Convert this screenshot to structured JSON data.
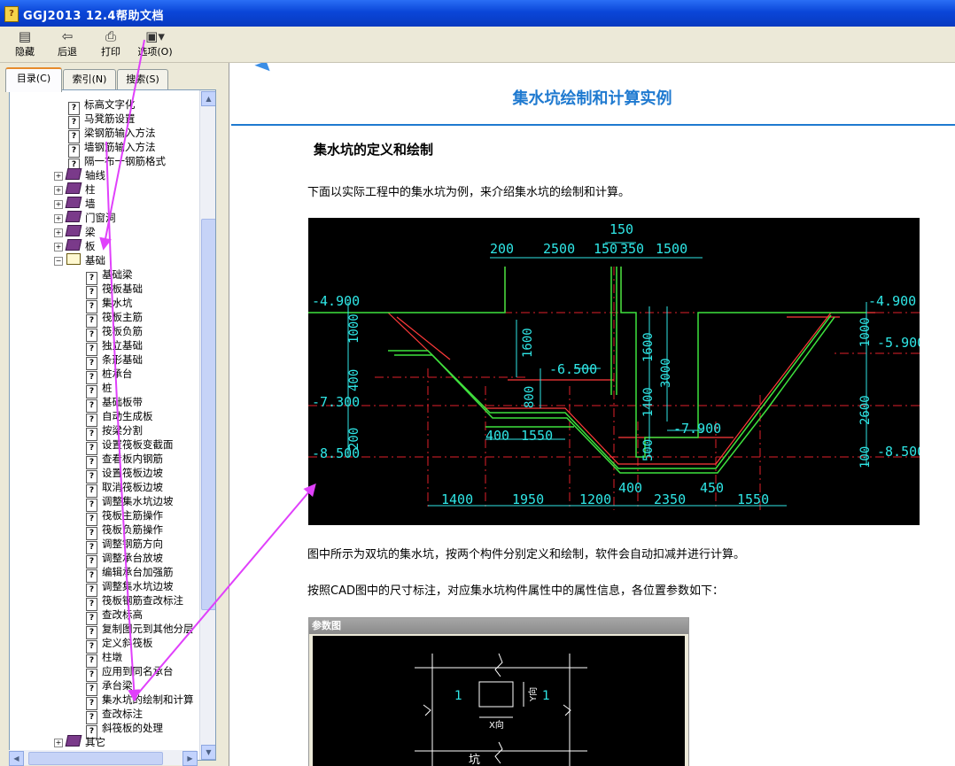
{
  "window": {
    "title": "GGJ2013 12.4帮助文档"
  },
  "toolbar": {
    "hide": "隐藏",
    "back": "后退",
    "print": "打印",
    "options": "选项(O)"
  },
  "tabs": {
    "contents": "目录(C)",
    "index": "索引(N)",
    "search": "搜索(S)"
  },
  "tree": {
    "items": [
      "标高文字化",
      "马凳筋设置",
      "梁钢筋输入方法",
      "墙钢筋输入方法",
      "隔一布一钢筋格式",
      "轴线",
      "柱",
      "墙",
      "门窗洞",
      "梁",
      "板",
      "基础",
      "基础梁",
      "筏板基础",
      "集水坑",
      "筏板主筋",
      "筏板负筋",
      "独立基础",
      "条形基础",
      "桩承台",
      "桩",
      "基础板带",
      "自动生成板",
      "按梁分割",
      "设置筏板变截面",
      "查看板内钢筋",
      "设置筏板边坡",
      "取消筏板边坡",
      "调整集水坑边坡",
      "筏板主筋操作",
      "筏板负筋操作",
      "调整钢筋方向",
      "调整承台放坡",
      "编辑承台加强筋",
      "调整集水坑边坡",
      "筏板钢筋查改标注",
      "查改标高",
      "复制图元到其他分层",
      "定义斜筏板",
      "柱墩",
      "应用到同名承台",
      "承台梁",
      "集水坑的绘制和计算",
      "查改标注",
      "斜筏板的处理",
      "其它"
    ]
  },
  "content": {
    "title": "集水坑绘制和计算实例",
    "section": "集水坑的定义和绘制",
    "intro": "下面以实际工程中的集水坑为例，来介绍集水坑的绘制和计算。",
    "p1": "图中所示为双坑的集水坑，按两个构件分别定义和绘制，软件会自动扣减并进行计算。",
    "p2": "按照CAD图中的尺寸标注，对应集水坑构件属性中的属性信息，各位置参数如下："
  },
  "cad": {
    "levels": [
      "-4.900",
      "-7.300",
      "-8.500",
      "-6.500",
      "-7.900",
      "-4.900",
      "-5.900",
      "-8.500"
    ],
    "top_dims": [
      "150",
      "200",
      "2500",
      "150",
      "350",
      "1500"
    ],
    "mid_dims": [
      "400",
      "1550"
    ],
    "bottom_dims": [
      "1400",
      "1950",
      "1200",
      "400",
      "2350",
      "450",
      "1550"
    ],
    "left_vdims": [
      "1000",
      "400",
      "200"
    ],
    "center_vdims": [
      "1600",
      "800",
      "1600",
      "3000",
      "1400",
      "500"
    ],
    "right_vdims": [
      "1000",
      "2600",
      "100"
    ]
  },
  "param": {
    "title": "参数图",
    "label1": "1",
    "label2": "1",
    "xdir": "X向",
    "ydir": "Y向",
    "bottom_label": "坑"
  },
  "colors": {
    "title_blue": "#1f7ad0",
    "arrow": "#e040fb"
  }
}
